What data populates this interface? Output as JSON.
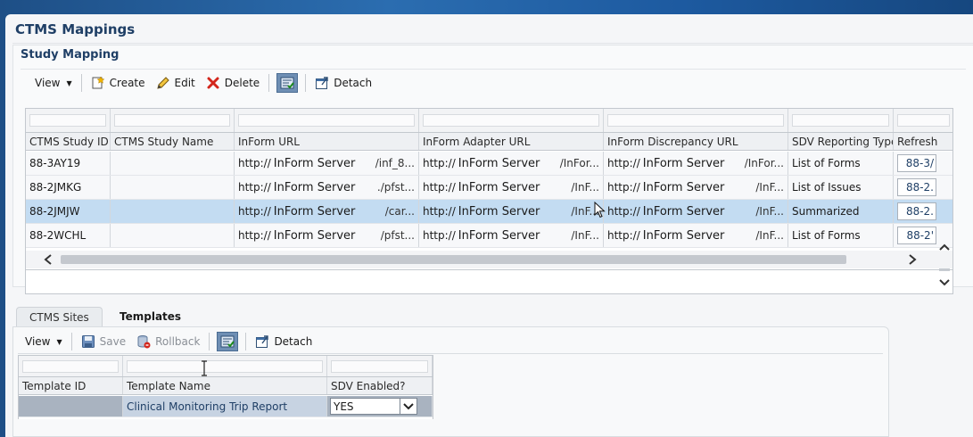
{
  "page_title": "CTMS Mappings",
  "study_mapping": {
    "title": "Study Mapping",
    "toolbar": {
      "view": "View",
      "create": "Create",
      "edit": "Edit",
      "delete": "Delete",
      "detach": "Detach"
    },
    "columns": [
      "CTMS Study ID",
      "CTMS Study Name",
      "InForm URL",
      "InForm Adapter URL",
      "InForm Discrepancy URL",
      "SDV Reporting Type",
      "Refresh"
    ],
    "rows": [
      {
        "study_id": "88-3AY19",
        "study_name": "",
        "inform_url": {
          "prefix": "http://",
          "server": "InForm Server",
          "suffix": "/inf_8..."
        },
        "adapter_url": {
          "prefix": "http://",
          "server": "InForm Server",
          "suffix": "/InFor..."
        },
        "discrepancy_url": {
          "prefix": "http://",
          "server": "InForm Server",
          "suffix": "/InFor..."
        },
        "sdv_type": "List of Forms",
        "refresh": "88-3/"
      },
      {
        "study_id": "88-2JMKG",
        "study_name": "",
        "inform_url": {
          "prefix": "http://",
          "server": "InForm Server",
          "suffix": "./pfst..."
        },
        "adapter_url": {
          "prefix": "http://",
          "server": "InForm Server",
          "suffix": "/InF..."
        },
        "discrepancy_url": {
          "prefix": "http://",
          "server": "InForm Server",
          "suffix": "/InF..."
        },
        "sdv_type": "List of Issues",
        "refresh": "88-2."
      },
      {
        "study_id": "88-2JMJW",
        "study_name": "",
        "inform_url": {
          "prefix": "http://",
          "server": "InForm Server",
          "suffix": "/car..."
        },
        "adapter_url": {
          "prefix": "http://",
          "server": "InForm Server",
          "suffix": "/InF..."
        },
        "discrepancy_url": {
          "prefix": "http://",
          "server": "InForm Server",
          "suffix": "/InF..."
        },
        "sdv_type": "Summarized",
        "refresh": "88-2."
      },
      {
        "study_id": "88-2WCHL",
        "study_name": "",
        "inform_url": {
          "prefix": "http://",
          "server": "InForm Server",
          "suffix": "/pfst..."
        },
        "adapter_url": {
          "prefix": "http://",
          "server": "InForm Server",
          "suffix": "/InF..."
        },
        "discrepancy_url": {
          "prefix": "http://",
          "server": "InForm Server",
          "suffix": "/InF..."
        },
        "sdv_type": "List of Forms",
        "refresh": "88-2'"
      }
    ],
    "selected_row_index": 2
  },
  "bottom_tabs": [
    "CTMS Sites",
    "Templates"
  ],
  "active_tab": "Templates",
  "templates": {
    "toolbar": {
      "view": "View",
      "save": "Save",
      "rollback": "Rollback",
      "detach": "Detach"
    },
    "columns": [
      "Template ID",
      "Template Name",
      "SDV Enabled?"
    ],
    "rows": [
      {
        "template_id": "",
        "template_name": "Clinical Monitoring Trip Report",
        "sdv_enabled": "YES"
      }
    ]
  },
  "colors": {
    "title": "#1f3f66",
    "selected_row": "#c3dcf2",
    "delete_icon": "#d3261c",
    "background_banner": "#1e4f86"
  }
}
